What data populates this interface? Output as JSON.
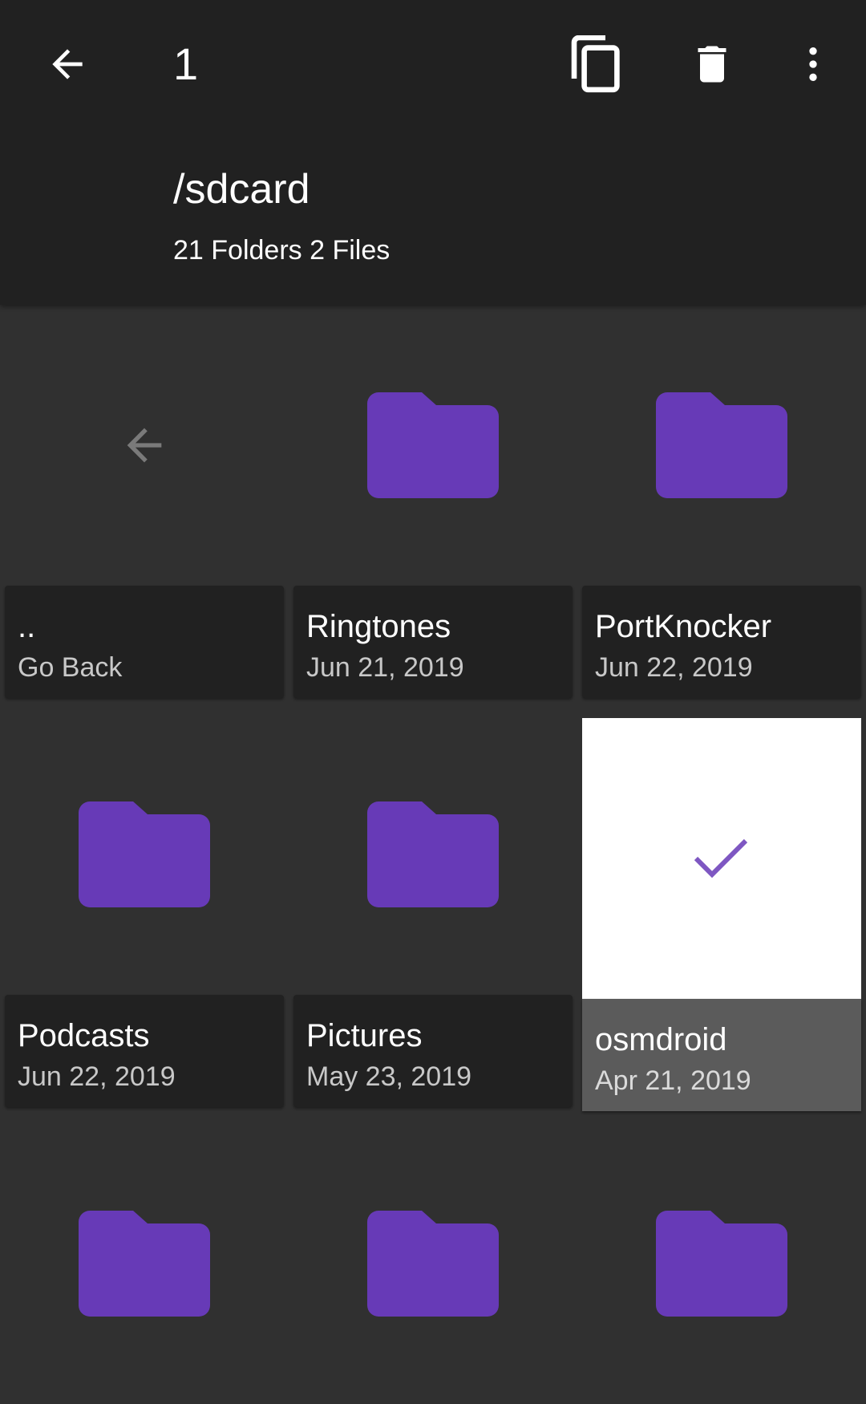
{
  "toolbar": {
    "selected_count": "1",
    "icons": [
      "arrow-back-icon",
      "copy-icon",
      "delete-icon",
      "more-vert-icon"
    ]
  },
  "header": {
    "path": "/sdcard",
    "summary": "21 Folders 2 Files"
  },
  "colors": {
    "toolbar_bg": "#212121",
    "content_bg": "#303030",
    "folder": "#673ab7",
    "selected_bg": "#ffffff",
    "selected_caption": "#5b5b5b"
  },
  "items": [
    {
      "name": "..",
      "meta": "Go Back",
      "icon": "arrow-back-icon",
      "selected": false
    },
    {
      "name": "Ringtones",
      "meta": "Jun 21, 2019",
      "icon": "folder-icon",
      "selected": false
    },
    {
      "name": "PortKnocker",
      "meta": "Jun 22, 2019",
      "icon": "folder-icon",
      "selected": false
    },
    {
      "name": "Podcasts",
      "meta": "Jun 22, 2019",
      "icon": "folder-icon",
      "selected": false
    },
    {
      "name": "Pictures",
      "meta": "May 23, 2019",
      "icon": "folder-icon",
      "selected": false
    },
    {
      "name": "osmdroid",
      "meta": "Apr 21, 2019",
      "icon": "check-icon",
      "selected": true
    },
    {
      "icon": "folder-icon",
      "selected": false
    },
    {
      "icon": "folder-icon",
      "selected": false
    },
    {
      "icon": "folder-icon",
      "selected": false
    }
  ]
}
